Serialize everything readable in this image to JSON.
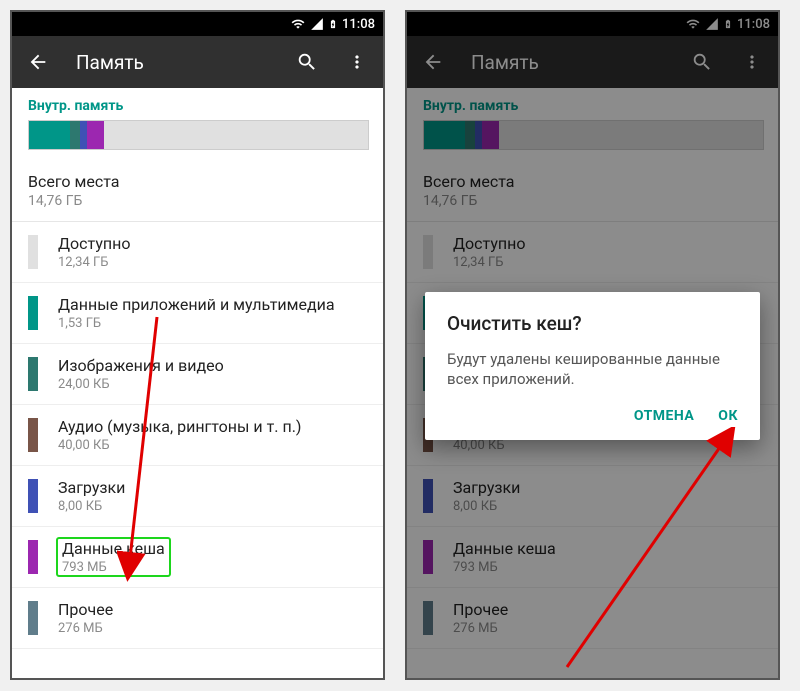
{
  "status": {
    "time": "11:08"
  },
  "appbar": {
    "title": "Память"
  },
  "section": {
    "internal": "Внутр. память"
  },
  "storage_segments": [
    {
      "color": "#009688",
      "pct": 12
    },
    {
      "color": "#2d786f",
      "pct": 3
    },
    {
      "color": "#3f51b5",
      "pct": 2
    },
    {
      "color": "#9c27b0",
      "pct": 5
    }
  ],
  "total": {
    "label": "Всего места",
    "value": "14,76 ГБ"
  },
  "items": [
    {
      "color": "#e0e0e0",
      "title": "Доступно",
      "sub": "12,34 ГБ"
    },
    {
      "color": "#009688",
      "title": "Данные приложений и мультимедиа",
      "sub": "1,53 ГБ"
    },
    {
      "color": "#2d786f",
      "title": "Изображения и видео",
      "sub": "24,00 КБ"
    },
    {
      "color": "#795548",
      "title": "Аудио (музыка, рингтоны и т. п.)",
      "sub": "40,00 КБ"
    },
    {
      "color": "#3f51b5",
      "title": "Загрузки",
      "sub": "8,00 КБ"
    },
    {
      "color": "#9c27b0",
      "title": "Данные кеша",
      "sub": "793 МБ"
    },
    {
      "color": "#607d8b",
      "title": "Прочее",
      "sub": "276 МБ"
    }
  ],
  "dialog": {
    "title": "Очистить кеш?",
    "body": "Будут удалены кешированные данные всех приложений.",
    "cancel": "ОТМЕНА",
    "ok": "ОК"
  }
}
